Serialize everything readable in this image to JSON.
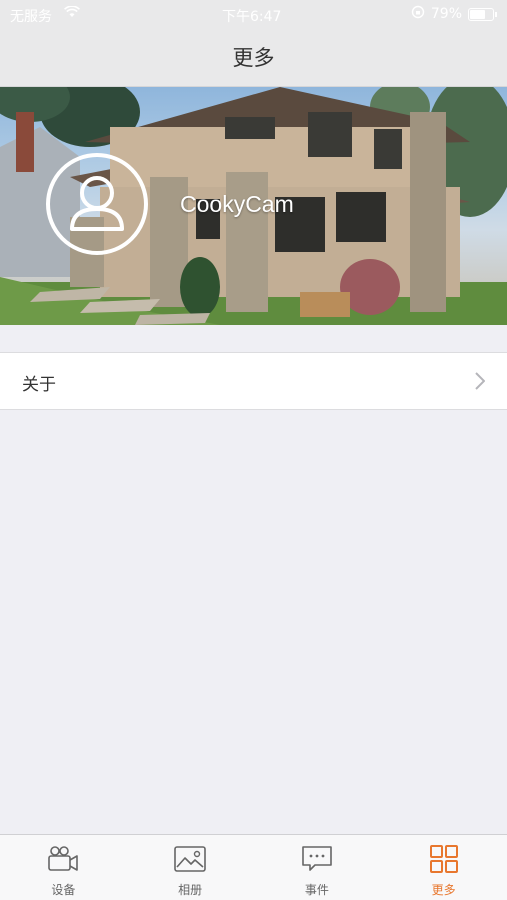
{
  "status_bar": {
    "carrier": "无服务",
    "time": "下午6:47",
    "battery": "79%"
  },
  "nav": {
    "title": "更多"
  },
  "profile": {
    "username": "CookyCam"
  },
  "menu": {
    "items": [
      {
        "label": "关于"
      }
    ]
  },
  "tabbar": {
    "tabs": [
      {
        "label": "设备",
        "icon": "video-camera-icon"
      },
      {
        "label": "相册",
        "icon": "photo-icon"
      },
      {
        "label": "事件",
        "icon": "chat-bubble-icon"
      },
      {
        "label": "更多",
        "icon": "grid-icon"
      }
    ],
    "active_color": "#e8772e",
    "inactive_color": "#666666"
  }
}
